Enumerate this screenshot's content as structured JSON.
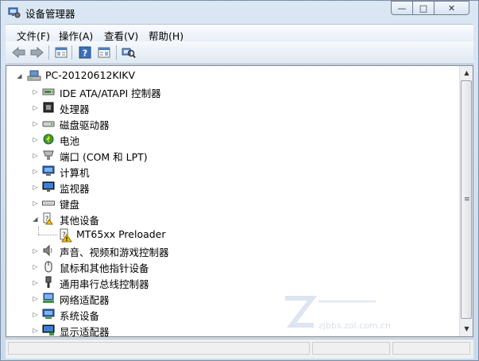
{
  "window": {
    "title": "设备管理器"
  },
  "caption_buttons": {
    "minimize": "—",
    "maximize": "□",
    "close": "✕"
  },
  "menu": {
    "items": [
      "文件(F)",
      "操作(A)",
      "查看(V)",
      "帮助(H)"
    ]
  },
  "toolbar": {
    "buttons": [
      "back-icon",
      "forward-icon",
      "properties-icon",
      "help-icon",
      "view-icon",
      "scan-hardware-icon"
    ]
  },
  "tree": {
    "root": {
      "label": "PC-20120612KIKV",
      "expanded": true
    },
    "nodes": [
      {
        "label": "IDE ATA/ATAPI 控制器",
        "icon": "ide-controller-icon",
        "expanded": false
      },
      {
        "label": "处理器",
        "icon": "processor-icon",
        "expanded": false
      },
      {
        "label": "磁盘驱动器",
        "icon": "disk-drive-icon",
        "expanded": false
      },
      {
        "label": "电池",
        "icon": "battery-icon",
        "expanded": false
      },
      {
        "label": "端口 (COM 和 LPT)",
        "icon": "port-icon",
        "expanded": false
      },
      {
        "label": "计算机",
        "icon": "computer-icon",
        "expanded": false
      },
      {
        "label": "监视器",
        "icon": "monitor-icon",
        "expanded": false
      },
      {
        "label": "键盘",
        "icon": "keyboard-icon",
        "expanded": false
      },
      {
        "label": "其他设备",
        "icon": "other-devices-icon",
        "expanded": true
      },
      {
        "label": "MT65xx Preloader",
        "icon": "unknown-device-warning-icon",
        "child": true
      },
      {
        "label": "声音、视频和游戏控制器",
        "icon": "sound-icon",
        "expanded": false
      },
      {
        "label": "鼠标和其他指针设备",
        "icon": "mouse-icon",
        "expanded": false
      },
      {
        "label": "通用串行总线控制器",
        "icon": "usb-icon",
        "expanded": false
      },
      {
        "label": "网络适配器",
        "icon": "network-adapter-icon",
        "expanded": false
      },
      {
        "label": "系统设备",
        "icon": "system-devices-icon",
        "expanded": false
      },
      {
        "label": "显示适配器",
        "icon": "display-adapter-icon",
        "expanded": false
      }
    ]
  },
  "scrollbar": {
    "up": "▲",
    "down": "▼",
    "grip": "≡"
  },
  "watermark": {
    "text": "zjbbs.zol.com.cn"
  },
  "colors": {
    "title_bar": "#dbe7f3",
    "warning": "#f0c000",
    "selection_blue": "#3a77c4"
  }
}
